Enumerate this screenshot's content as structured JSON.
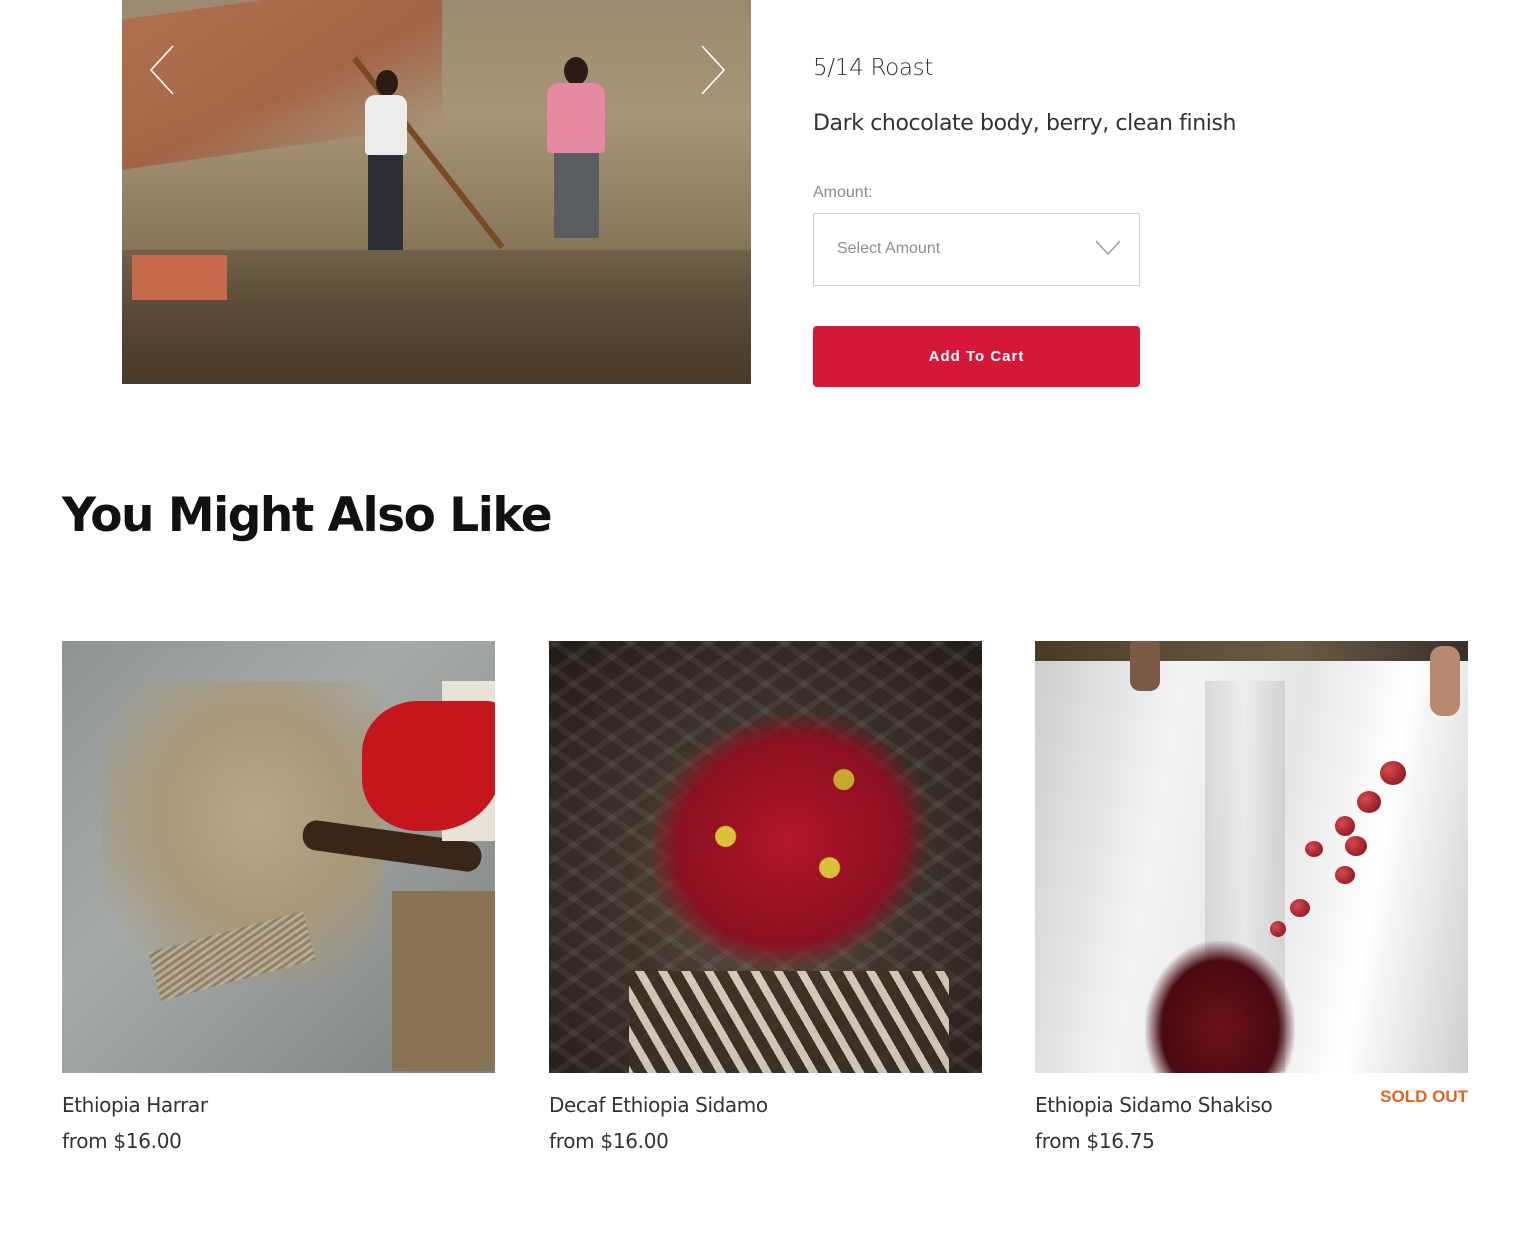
{
  "product": {
    "roast": "5/14 Roast",
    "notes": "Dark chocolate body, berry, clean finish",
    "amount_label": "Amount:",
    "select_placeholder": "Select Amount",
    "add_to_cart": "Add To Cart"
  },
  "gallery": {
    "prev_icon": "chevron-left-icon",
    "next_icon": "chevron-right-icon"
  },
  "related": {
    "title": "You Might Also Like",
    "items": [
      {
        "name": "Ethiopia Harrar",
        "price": "from $16.00",
        "badge": ""
      },
      {
        "name": "Decaf Ethiopia Sidamo",
        "price": "from $16.00",
        "badge": ""
      },
      {
        "name": "Ethiopia Sidamo Shakiso",
        "price": "from $16.75",
        "badge": "SOLD OUT"
      }
    ]
  },
  "colors": {
    "accent": "#d5183a",
    "sold_out": "#e5631d"
  }
}
